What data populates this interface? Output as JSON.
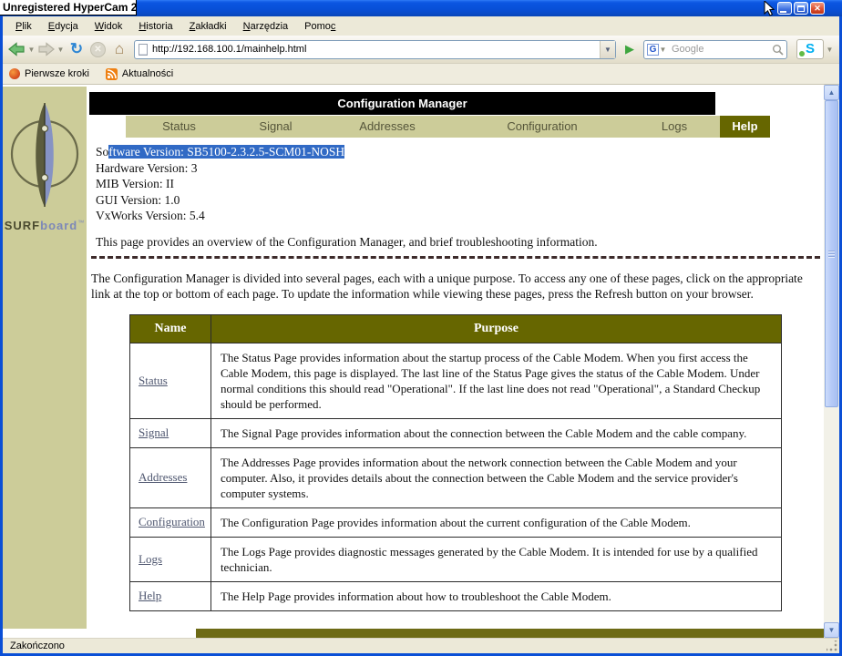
{
  "window": {
    "title": "Unregistered HyperCam 2",
    "controls": {
      "minimize": "minimize",
      "maximize": "maximize",
      "close": "✕"
    }
  },
  "browser": {
    "menus": [
      {
        "label": "Plik",
        "key": "plik",
        "underline": 0
      },
      {
        "label": "Edycja",
        "key": "edycja",
        "underline": 0
      },
      {
        "label": "Widok",
        "key": "widok",
        "underline": 0
      },
      {
        "label": "Historia",
        "key": "historia",
        "underline": 0
      },
      {
        "label": "Zakładki",
        "key": "zakladki",
        "underline": 0
      },
      {
        "label": "Narzędzia",
        "key": "narzedzia",
        "underline": 0
      },
      {
        "label": "Pomoc",
        "key": "pomoc",
        "underline": 4
      }
    ],
    "url": "http://192.168.100.1/mainhelp.html",
    "search_placeholder": "Google",
    "search_engine_letter": "G",
    "go_glyph": "▶",
    "reload_glyph": "↻",
    "stop_glyph": "✕",
    "home_glyph": "⌂",
    "skype_letter": "S",
    "bookmarks": [
      {
        "label": "Pierwsze kroki",
        "icon": "firefox-start-icon"
      },
      {
        "label": "Aktualności",
        "icon": "rss-icon"
      }
    ],
    "status": "Zakończono"
  },
  "page": {
    "brand": {
      "surf": "SURF",
      "board": "board",
      "tm": "™"
    },
    "header": "Configuration Manager",
    "tabs": [
      {
        "label": "Status",
        "active": false
      },
      {
        "label": "Signal",
        "active": false
      },
      {
        "label": "Addresses",
        "active": false
      },
      {
        "label": "Configuration",
        "active": false
      },
      {
        "label": "Logs",
        "active": false
      },
      {
        "label": "Help",
        "active": true
      }
    ],
    "versions": {
      "line1_prefix": "So",
      "line1_selected": "ftware Version: SB5100-2.3.2.5-SCM01-NOSH",
      "lines": [
        "Hardware Version: 3",
        "MIB Version: II",
        "GUI Version: 1.0",
        "VxWorks Version: 5.4"
      ]
    },
    "intro": "This page provides an overview of the Configuration Manager, and brief troubleshooting information.",
    "description": "The Configuration Manager is divided into several pages, each with a unique purpose. To access any one of these pages, click on the appropriate link at the top or bottom of each page. To update the information while viewing these pages, press the Refresh button on your browser.",
    "table": {
      "headers": [
        "Name",
        "Purpose"
      ],
      "rows": [
        {
          "name": "Status",
          "purpose": "The Status Page provides information about the startup process of the Cable Modem. When you first access the Cable Modem, this page is displayed. The last line of the Status Page gives the status of the Cable Modem. Under normal conditions this should read \"Operational\". If the last line does not read \"Operational\", a Standard Checkup should be performed."
        },
        {
          "name": "Signal",
          "purpose": "The Signal Page provides information about the connection between the Cable Modem and the cable company."
        },
        {
          "name": "Addresses",
          "purpose": "The Addresses Page provides information about the network connection between the Cable Modem and your computer. Also, it provides details about the connection between the Cable Modem and the service provider's computer systems."
        },
        {
          "name": "Configuration",
          "purpose": "The Configuration Page provides information about the current configuration of the Cable Modem."
        },
        {
          "name": "Logs",
          "purpose": "The Logs Page provides diagnostic messages generated by the Cable Modem. It is intended for use by a qualified technician."
        },
        {
          "name": "Help",
          "purpose": "The Help Page provides information about how to troubleshoot the Cable Modem."
        }
      ]
    }
  },
  "colors": {
    "khaki": "#CCCC99",
    "dark_olive": "#666600",
    "header_black": "#000000",
    "selection_blue": "#316AC5",
    "xp_title_blue": "#0850D8"
  }
}
